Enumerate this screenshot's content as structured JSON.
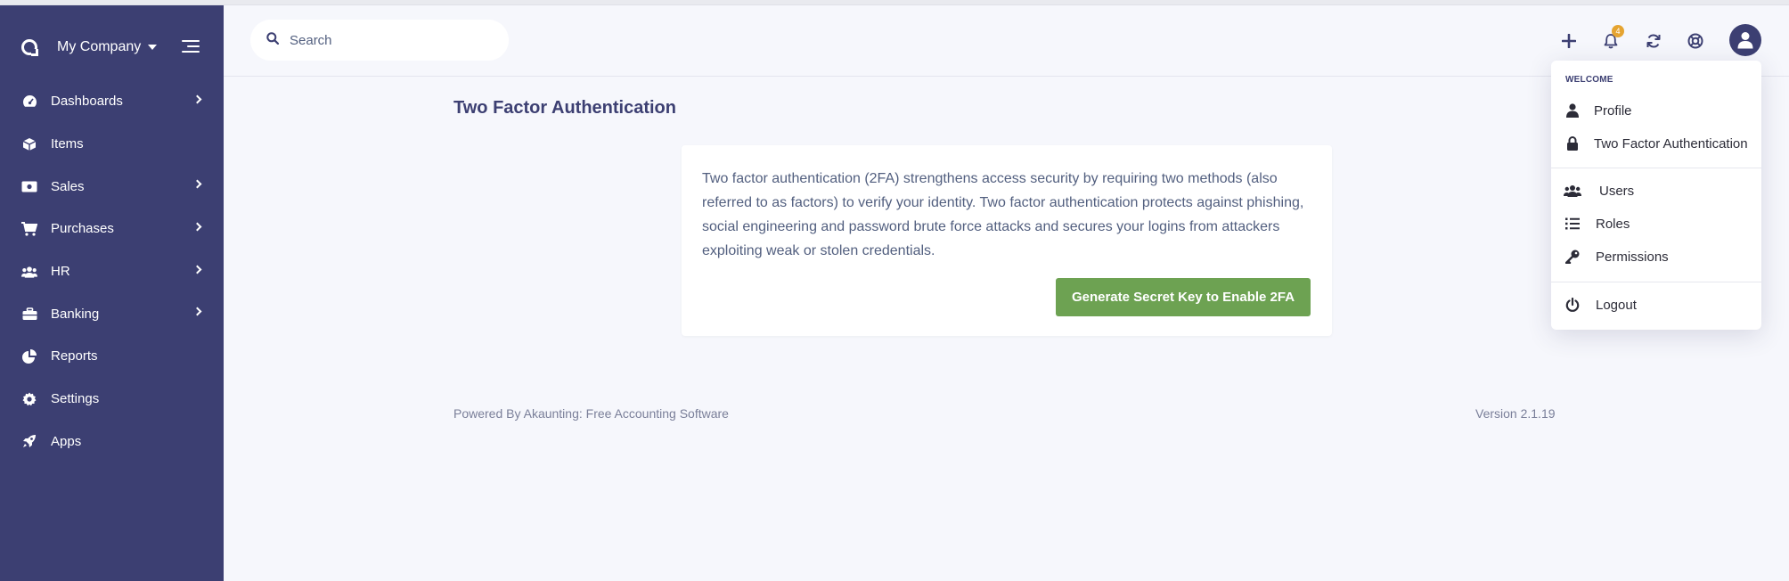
{
  "sidebar": {
    "company": "My Company",
    "items": [
      {
        "label": "Dashboards",
        "icon": "dashboard-icon",
        "has_children": true
      },
      {
        "label": "Items",
        "icon": "cube-icon",
        "has_children": false
      },
      {
        "label": "Sales",
        "icon": "money-icon",
        "has_children": true
      },
      {
        "label": "Purchases",
        "icon": "cart-icon",
        "has_children": true
      },
      {
        "label": "HR",
        "icon": "users-icon",
        "has_children": true
      },
      {
        "label": "Banking",
        "icon": "briefcase-icon",
        "has_children": true
      },
      {
        "label": "Reports",
        "icon": "pie-chart-icon",
        "has_children": false
      },
      {
        "label": "Settings",
        "icon": "gear-icon",
        "has_children": false
      },
      {
        "label": "Apps",
        "icon": "rocket-icon",
        "has_children": false
      }
    ]
  },
  "topbar": {
    "search_placeholder": "Search",
    "notification_count": "4"
  },
  "main": {
    "title": "Two Factor Authentication",
    "description": "Two factor authentication (2FA) strengthens access security by requiring two methods (also referred to as factors) to verify your identity. Two factor authentication protects against phishing, social engineering and password brute force attacks and secures your logins from attackers exploiting weak or stolen credentials.",
    "button_label": "Generate Secret Key to Enable 2FA"
  },
  "footer": {
    "powered_by": "Powered By Akaunting: Free Accounting Software",
    "version": "Version 2.1.19"
  },
  "user_menu": {
    "header": "WELCOME",
    "items": [
      {
        "label": "Profile",
        "icon": "user-icon"
      },
      {
        "label": "Two Factor Authentication",
        "icon": "lock-icon"
      },
      {
        "label": "Users",
        "icon": "users-icon"
      },
      {
        "label": "Roles",
        "icon": "list-icon"
      },
      {
        "label": "Permissions",
        "icon": "key-icon"
      },
      {
        "label": "Logout",
        "icon": "power-icon"
      }
    ]
  },
  "colors": {
    "sidebar_bg": "#3c3f72",
    "accent_green": "#6da252",
    "badge_orange": "#e5a431",
    "page_bg": "#f6f7fc"
  }
}
